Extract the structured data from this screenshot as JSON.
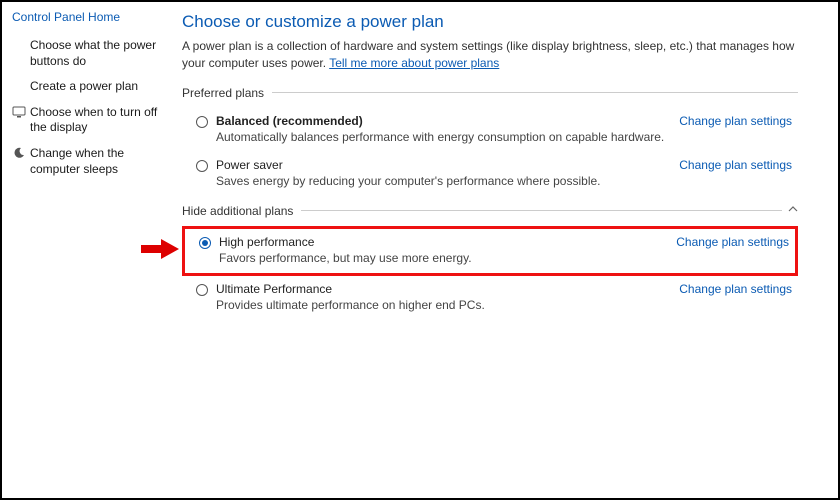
{
  "sidebar": {
    "home": "Control Panel Home",
    "items": [
      {
        "label": "Choose what the power buttons do",
        "icon": ""
      },
      {
        "label": "Create a power plan",
        "icon": ""
      },
      {
        "label": "Choose when to turn off the display",
        "icon": "display-icon"
      },
      {
        "label": "Change when the computer sleeps",
        "icon": "moon-icon"
      }
    ]
  },
  "main": {
    "title": "Choose or customize a power plan",
    "description_pre": "A power plan is a collection of hardware and system settings (like display brightness, sleep, etc.) that manages how your computer uses power. ",
    "description_link": "Tell me more about power plans"
  },
  "sections": {
    "preferred": "Preferred plans",
    "additional": "Hide additional plans"
  },
  "plans": {
    "balanced": {
      "name": "Balanced (recommended)",
      "desc": "Automatically balances performance with energy consumption on capable hardware.",
      "link": "Change plan settings"
    },
    "powersaver": {
      "name": "Power saver",
      "desc": "Saves energy by reducing your computer's performance where possible.",
      "link": "Change plan settings"
    },
    "highperf": {
      "name": "High performance",
      "desc": "Favors performance, but may use more energy.",
      "link": "Change plan settings"
    },
    "ultimate": {
      "name": "Ultimate Performance",
      "desc": "Provides ultimate performance on higher end PCs.",
      "link": "Change plan settings"
    }
  }
}
